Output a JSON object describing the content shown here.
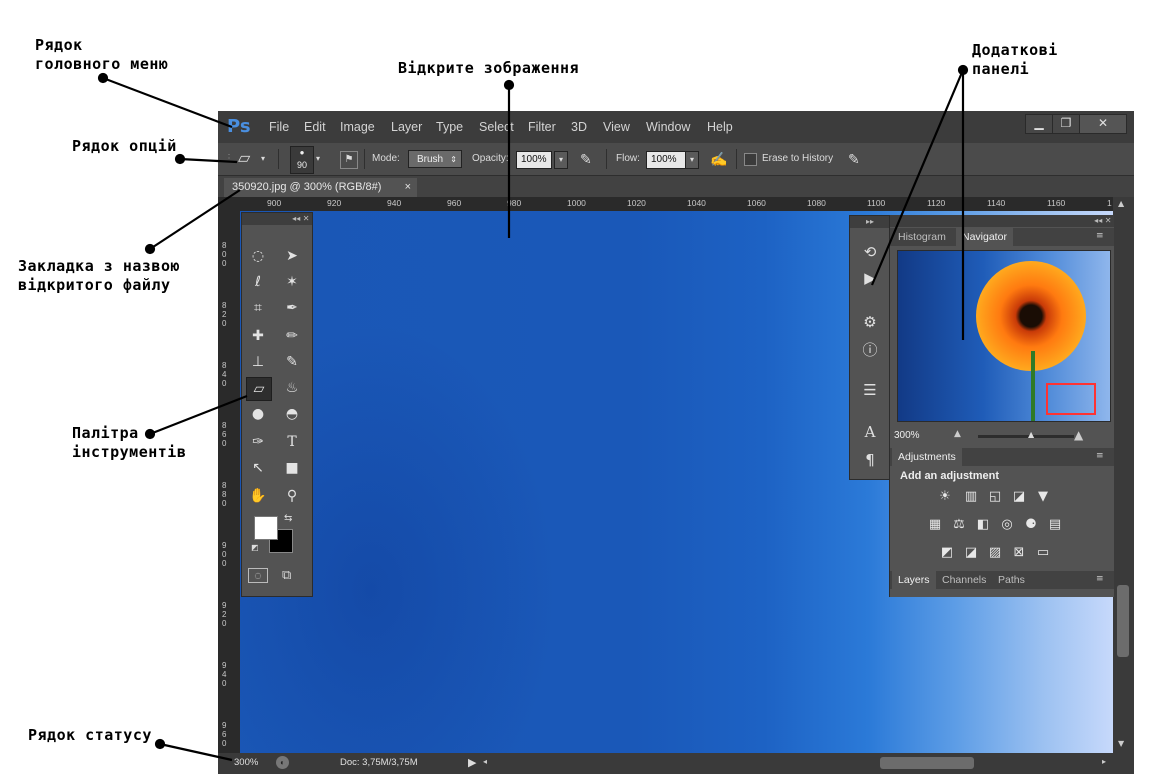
{
  "annotations": {
    "main_menu": "Рядок\nголовного меню",
    "open_image": "Відкрите зображення",
    "extra_panels": "Додаткові\nпанелі",
    "options_bar": "Рядок опцій",
    "file_tab": "Закладка з назвою\nвідкритого файлу",
    "tools_palette": "Палітра\nінструментів",
    "status_bar": "Рядок статусу"
  },
  "app": {
    "logo": "Ps"
  },
  "menu": [
    "File",
    "Edit",
    "Image",
    "Layer",
    "Type",
    "Select",
    "Filter",
    "3D",
    "View",
    "Window",
    "Help"
  ],
  "window_controls": [
    "▁",
    "❐",
    "✕"
  ],
  "options": {
    "brush_size": "90",
    "mode_label": "Mode:",
    "mode_value": "Brush",
    "opacity_label": "Opacity:",
    "opacity_value": "100%",
    "flow_label": "Flow:",
    "flow_value": "100%",
    "erase_history": "Erase to History"
  },
  "document_tab": {
    "title": "350920.jpg @ 300% (RGB/8#)",
    "close": "×"
  },
  "ruler": {
    "h_ticks": [
      "900",
      "920",
      "940",
      "960",
      "980",
      "1000",
      "1020",
      "1040",
      "1060",
      "1080",
      "1100",
      "1120",
      "1140",
      "1160",
      "1"
    ],
    "v_ticks": [
      "8\n0\n0",
      "8\n2\n0",
      "8\n4\n0",
      "8\n6\n0",
      "8\n8\n0",
      "9\n0\n0",
      "9\n2\n0",
      "9\n4\n0",
      "9\n6\n0"
    ]
  },
  "status": {
    "zoom": "300%",
    "doc": "Doc: 3,75M/3,75M"
  },
  "panels": {
    "histogram_tab": "Histogram",
    "navigator_tab": "Navigator",
    "navigator_zoom": "300%",
    "adjustments_title": "Adjustments",
    "add_adjustment": "Add an adjustment",
    "layers_tab": "Layers",
    "channels_tab": "Channels",
    "paths_tab": "Paths"
  },
  "colors": {
    "accent": "#4a8fe0",
    "canvas_blue": "#1a58b8",
    "panel_bg": "#535353",
    "navigator_frame": "#ff3333"
  },
  "icons": {
    "tools": [
      "marquee-icon",
      "move-icon",
      "lasso-icon",
      "magic-wand-icon",
      "crop-icon",
      "eyedropper-icon",
      "healing-icon",
      "brush-icon",
      "stamp-icon",
      "history-brush-icon",
      "eraser-icon",
      "paint-bucket-icon",
      "blur-icon",
      "dodge-icon",
      "pen-icon",
      "type-icon",
      "path-select-icon",
      "shape-icon",
      "hand-icon",
      "zoom-icon"
    ]
  }
}
